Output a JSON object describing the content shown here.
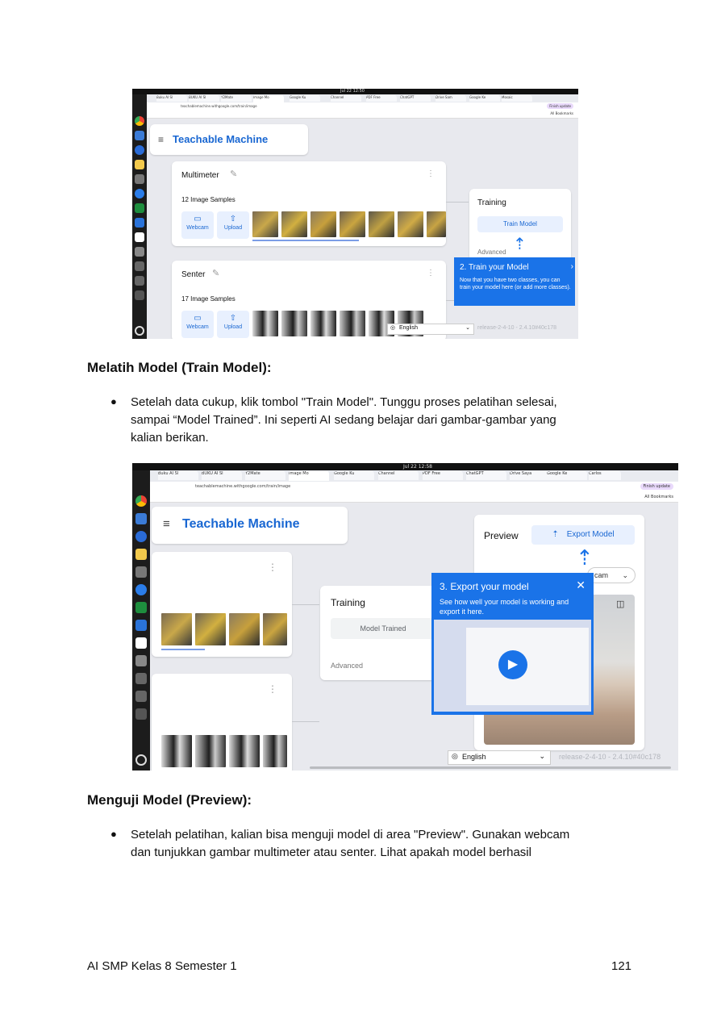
{
  "section1": {
    "heading": "Melatih Model (Train Model):",
    "bullet": "Setelah data cukup, klik tombol \"Train Model\". Tunggu proses pelatihan selesai, sampai “Model Trained”. Ini seperti AI sedang belajar dari gambar-gambar yang kalian berikan.",
    "bullet_lines": [
      "Setelah data cukup, klik tombol \"Train Model\". Tunggu proses pelatihan selesai,",
      "sampai “Model Trained”. Ini seperti AI sedang belajar dari gambar-gambar yang",
      "kalian berikan."
    ]
  },
  "section2": {
    "heading": "Menguji Model (Preview):",
    "bullet_lines": [
      "Setelah pelatihan, kalian bisa menguji model di area \"Preview\". Gunakan webcam",
      "dan tunjukkan gambar multimeter atau senter. Lihat apakah model berhasil"
    ]
  },
  "footer": {
    "left": "AI SMP Kelas 8 Semester 1",
    "page_number": "121"
  },
  "screenshot1": {
    "clock": "Jul 22  12:50",
    "url": "teachablemachine.withgoogle.com/train/image",
    "bookmarks": "All Bookmarks",
    "update_btn": "Finish update",
    "tabs": [
      "Buku AI Sl",
      "BUKU AI SI",
      "Y2Mate",
      "Image Mo",
      "Google Ku",
      "Channel",
      "PDF Free",
      "ChatGPT",
      "Drive Sam",
      "Google Ke",
      "Mosaic"
    ],
    "app_title": "Teachable Machine",
    "class1": {
      "name": "Multimeter",
      "samples": "12 Image Samples",
      "webcam": "Webcam",
      "upload": "Upload"
    },
    "class2": {
      "name": "Senter",
      "samples": "17 Image Samples",
      "webcam": "Webcam",
      "upload": "Upload"
    },
    "training": {
      "title": "Training",
      "button": "Train Model",
      "advanced": "Advanced"
    },
    "tip": {
      "title": "2. Train your Model",
      "body": "Now that you have two classes, you can train your model here (or add more classes)."
    },
    "language": "English",
    "release": "release-2-4-10 - 2.4.10#40c178"
  },
  "screenshot2": {
    "clock": "Jul 22  12:58",
    "url": "teachablemachine.withgoogle.com/train/image",
    "bookmarks": "All Bookmarks",
    "update_btn": "Finish update",
    "tabs": [
      "Buku AI Sl",
      "BUKU AI SI",
      "Y2Mate",
      "Image Mo",
      "Google Ku",
      "Channel",
      "PDF Free",
      "ChatGPT",
      "Drive Saya",
      "Google Ke",
      "Carlos"
    ],
    "app_title": "Teachable Machine",
    "preview": {
      "title": "Preview",
      "export_btn": "Export Model",
      "webcam_select": "cam"
    },
    "training": {
      "title": "Training",
      "button": "Model Trained",
      "advanced": "Advanced"
    },
    "tip": {
      "title": "3. Export your model",
      "body": "See how well your model is working and export it here."
    },
    "language": "English",
    "release": "release-2-4-10 - 2.4.10#40c178"
  },
  "colors": {
    "accent": "#1a73e8",
    "brand_text": "#1967d2",
    "chip_bg": "#e8f0fe"
  }
}
